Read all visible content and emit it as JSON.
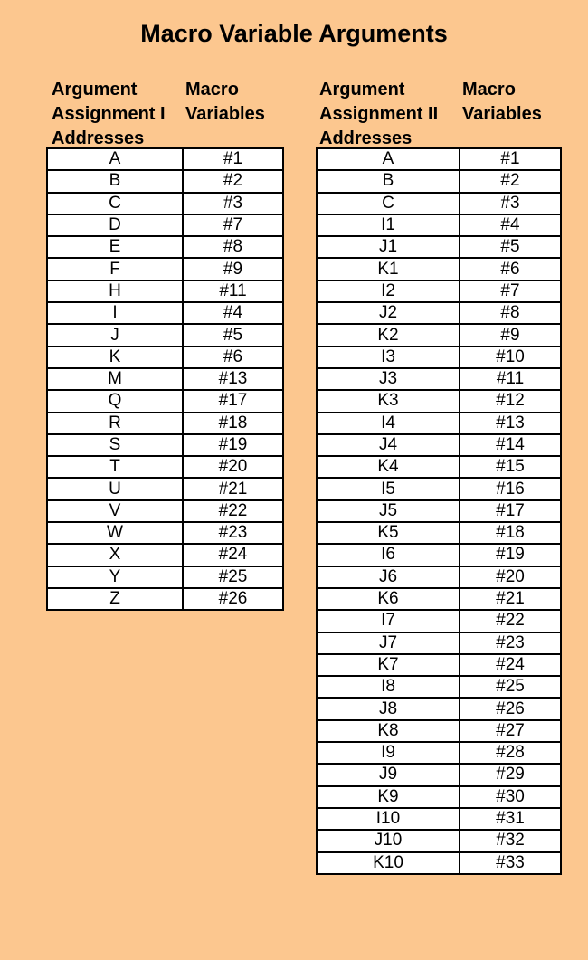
{
  "title": "Macro Variable Arguments",
  "left": {
    "header_address": "Argument\nAssignment I\nAddresses",
    "header_variable": "Macro\nVariables",
    "rows": [
      [
        "A",
        "#1"
      ],
      [
        "B",
        "#2"
      ],
      [
        "C",
        "#3"
      ],
      [
        "D",
        "#7"
      ],
      [
        "E",
        "#8"
      ],
      [
        "F",
        "#9"
      ],
      [
        "H",
        "#11"
      ],
      [
        "I",
        "#4"
      ],
      [
        "J",
        "#5"
      ],
      [
        "K",
        "#6"
      ],
      [
        "M",
        "#13"
      ],
      [
        "Q",
        "#17"
      ],
      [
        "R",
        "#18"
      ],
      [
        "S",
        "#19"
      ],
      [
        "T",
        "#20"
      ],
      [
        "U",
        "#21"
      ],
      [
        "V",
        "#22"
      ],
      [
        "W",
        "#23"
      ],
      [
        "X",
        "#24"
      ],
      [
        "Y",
        "#25"
      ],
      [
        "Z",
        "#26"
      ]
    ]
  },
  "right": {
    "header_address": "Argument\nAssignment II\nAddresses",
    "header_variable": "Macro\nVariables",
    "rows": [
      [
        "A",
        "#1"
      ],
      [
        "B",
        "#2"
      ],
      [
        "C",
        "#3"
      ],
      [
        "I1",
        "#4"
      ],
      [
        "J1",
        "#5"
      ],
      [
        "K1",
        "#6"
      ],
      [
        "I2",
        "#7"
      ],
      [
        "J2",
        "#8"
      ],
      [
        "K2",
        "#9"
      ],
      [
        "I3",
        "#10"
      ],
      [
        "J3",
        "#11"
      ],
      [
        "K3",
        "#12"
      ],
      [
        "I4",
        "#13"
      ],
      [
        "J4",
        "#14"
      ],
      [
        "K4",
        "#15"
      ],
      [
        "I5",
        "#16"
      ],
      [
        "J5",
        "#17"
      ],
      [
        "K5",
        "#18"
      ],
      [
        "I6",
        "#19"
      ],
      [
        "J6",
        "#20"
      ],
      [
        "K6",
        "#21"
      ],
      [
        "I7",
        "#22"
      ],
      [
        "J7",
        "#23"
      ],
      [
        "K7",
        "#24"
      ],
      [
        "I8",
        "#25"
      ],
      [
        "J8",
        "#26"
      ],
      [
        "K8",
        "#27"
      ],
      [
        "I9",
        "#28"
      ],
      [
        "J9",
        "#29"
      ],
      [
        "K9",
        "#30"
      ],
      [
        "I10",
        "#31"
      ],
      [
        "J10",
        "#32"
      ],
      [
        "K10",
        "#33"
      ]
    ]
  }
}
